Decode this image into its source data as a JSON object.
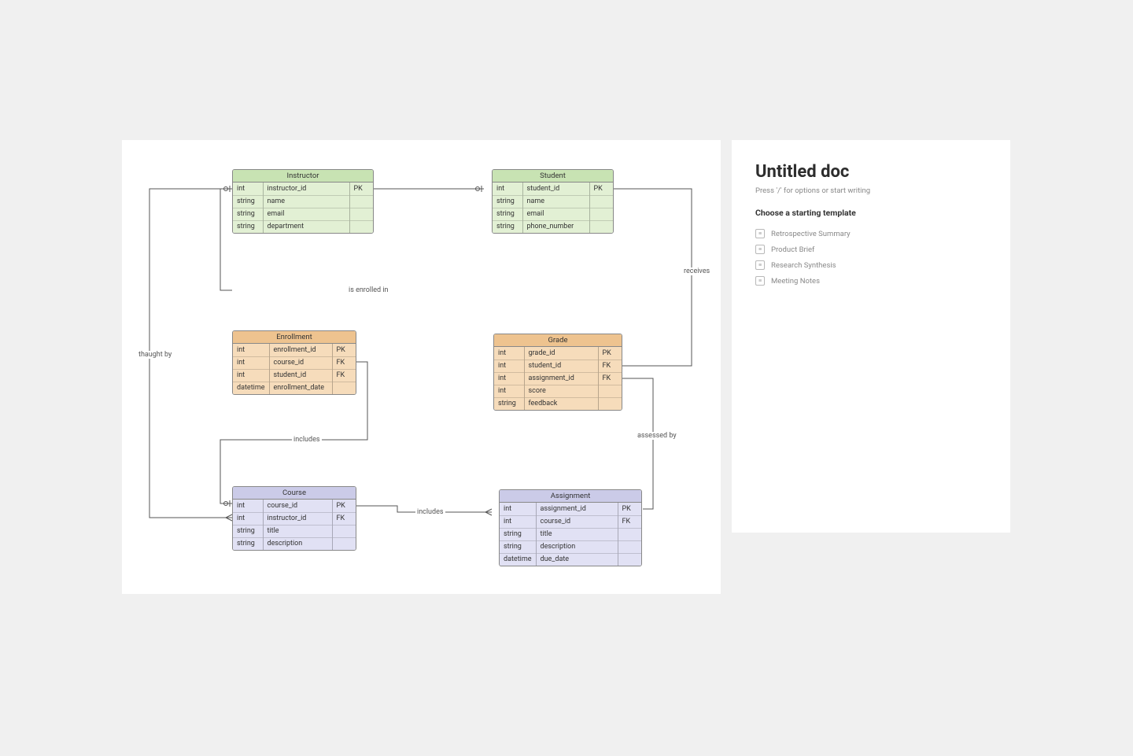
{
  "side": {
    "title": "Untitled doc",
    "hint": "Press '/' for options or start writing",
    "templates_heading": "Choose a starting template",
    "templates": [
      "Retrospective Summary",
      "Product Brief",
      "Research Synthesis",
      "Meeting Notes"
    ]
  },
  "relations": {
    "taught_by": "thaught by",
    "is_enrolled_in": "is enrolled in",
    "receives": "receives",
    "includes1": "includes",
    "includes2": "includes",
    "assessed_by": "assessed by"
  },
  "entities": {
    "instructor": {
      "title": "Instructor",
      "rows": [
        [
          "int",
          "instructor_id",
          "PK"
        ],
        [
          "string",
          "name",
          ""
        ],
        [
          "string",
          "email",
          ""
        ],
        [
          "string",
          "department",
          ""
        ]
      ]
    },
    "student": {
      "title": "Student",
      "rows": [
        [
          "int",
          "student_id",
          "PK"
        ],
        [
          "string",
          "name",
          ""
        ],
        [
          "string",
          "email",
          ""
        ],
        [
          "string",
          "phone_number",
          ""
        ]
      ]
    },
    "enrollment": {
      "title": "Enrollment",
      "rows": [
        [
          "int",
          "enrollment_id",
          "PK"
        ],
        [
          "int",
          "course_id",
          "FK"
        ],
        [
          "int",
          "student_id",
          "FK"
        ],
        [
          "datetime",
          "enrollment_date",
          ""
        ]
      ]
    },
    "grade": {
      "title": "Grade",
      "rows": [
        [
          "int",
          "grade_id",
          "PK"
        ],
        [
          "int",
          "student_id",
          "FK"
        ],
        [
          "int",
          "assignment_id",
          "FK"
        ],
        [
          "int",
          "score",
          ""
        ],
        [
          "string",
          "feedback",
          ""
        ]
      ]
    },
    "course": {
      "title": "Course",
      "rows": [
        [
          "int",
          "course_id",
          "PK"
        ],
        [
          "int",
          "instructor_id",
          "FK"
        ],
        [
          "string",
          "title",
          ""
        ],
        [
          "string",
          "description",
          ""
        ]
      ]
    },
    "assignment": {
      "title": "Assignment",
      "rows": [
        [
          "int",
          "assignment_id",
          "PK"
        ],
        [
          "int",
          "course_id",
          "FK"
        ],
        [
          "string",
          "title",
          ""
        ],
        [
          "string",
          "description",
          ""
        ],
        [
          "datetime",
          "due_date",
          ""
        ]
      ]
    }
  }
}
